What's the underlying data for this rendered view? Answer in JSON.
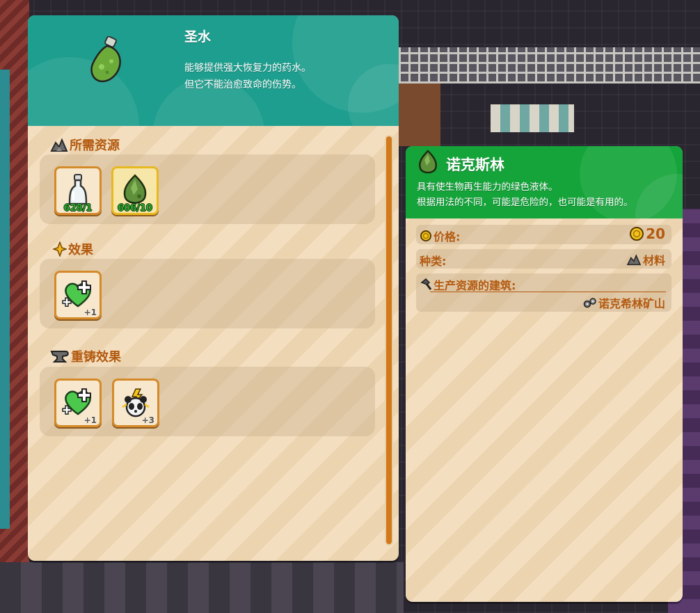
{
  "item_panel": {
    "title": "圣水",
    "description_lines": [
      "能够提供强大恢复力的药水。",
      "但它不能治愈致命的伤势。"
    ],
    "icon": "green-potion-icon",
    "sections": {
      "resources": {
        "title": "所需资源",
        "icon": "ore-pile-icon",
        "items": [
          {
            "icon": "glass-bottle-icon",
            "count": "628/1",
            "highlight": false
          },
          {
            "icon": "nokrin-crystal-icon",
            "count": "606/10",
            "highlight": true
          }
        ]
      },
      "effects": {
        "title": "效果",
        "icon": "sparkle-icon",
        "items": [
          {
            "icon": "green-heart-plus-icon",
            "bonus": "+1"
          }
        ]
      },
      "reforge": {
        "title": "重铸效果",
        "icon": "anvil-icon",
        "items": [
          {
            "icon": "green-heart-plus-icon",
            "bonus": "+1"
          },
          {
            "icon": "panda-lightning-icon",
            "bonus": "+3"
          }
        ]
      }
    }
  },
  "material_panel": {
    "title": "诺克斯林",
    "icon": "nokrin-crystal-icon",
    "description_lines": [
      "具有使生物再生能力的绿色液体。",
      "根据用法的不同，可能是危险的，也可能是有用的。"
    ],
    "rows": {
      "price": {
        "label": "价格:",
        "value": "20",
        "icon": "gold-coin-icon"
      },
      "type": {
        "label": "种类:",
        "value": "材料",
        "icon": "ore-pile-icon"
      },
      "building": {
        "label": "生产资源的建筑:",
        "value": "诺克希林矿山",
        "label_icon": "hammer-icon",
        "value_icon": "gears-icon"
      }
    }
  },
  "colors": {
    "header_teal": "#1e9e8e",
    "header_green": "#14a43a",
    "accent_orange": "#b35a10",
    "panel_cream": "#f3dfc0",
    "count_green": "#2ea52e"
  }
}
